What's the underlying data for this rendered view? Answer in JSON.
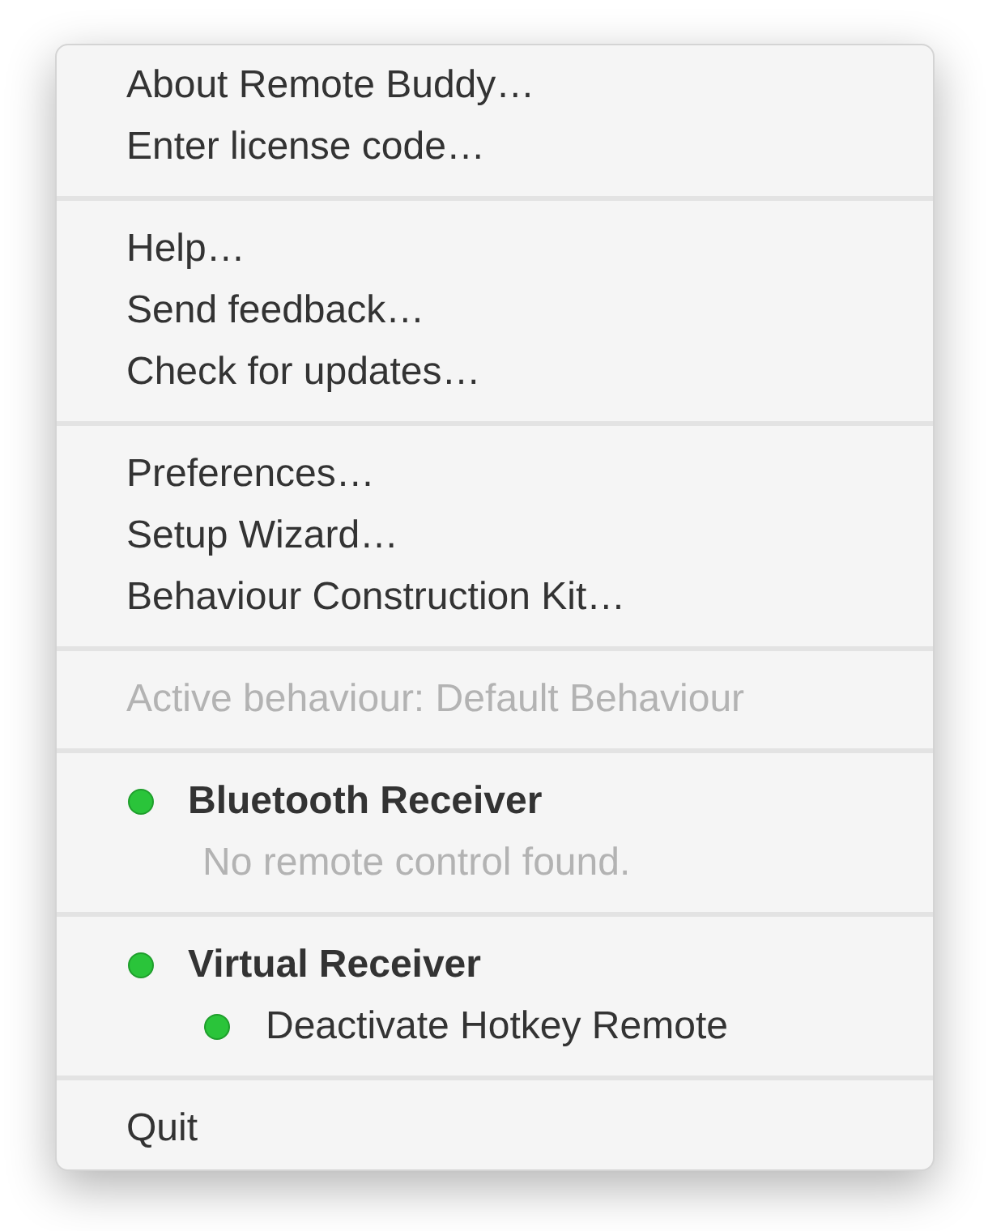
{
  "sections": [
    {
      "items": [
        {
          "kind": "command",
          "label": "About Remote Buddy…"
        },
        {
          "kind": "command",
          "label": "Enter license code…"
        }
      ]
    },
    {
      "items": [
        {
          "kind": "command",
          "label": "Help…"
        },
        {
          "kind": "command",
          "label": "Send feedback…"
        },
        {
          "kind": "command",
          "label": "Check for updates…"
        }
      ]
    },
    {
      "items": [
        {
          "kind": "command",
          "label": "Preferences…"
        },
        {
          "kind": "command",
          "label": "Setup Wizard…"
        },
        {
          "kind": "command",
          "label": "Behaviour Construction Kit…"
        }
      ]
    },
    {
      "items": [
        {
          "kind": "info",
          "label": "Active behaviour: Default Behaviour"
        }
      ]
    },
    {
      "items": [
        {
          "kind": "receiver",
          "label": "Bluetooth Receiver",
          "color": "#2ac43a",
          "children": [
            {
              "kind": "info",
              "label": "No remote control found."
            }
          ]
        }
      ]
    },
    {
      "items": [
        {
          "kind": "receiver",
          "label": "Virtual Receiver",
          "color": "#2ac43a",
          "children": [
            {
              "kind": "toggle",
              "label": "Deactivate Hotkey Remote",
              "color": "#2ac43a"
            }
          ]
        }
      ]
    },
    {
      "items": [
        {
          "kind": "command",
          "label": "Quit"
        }
      ]
    }
  ]
}
